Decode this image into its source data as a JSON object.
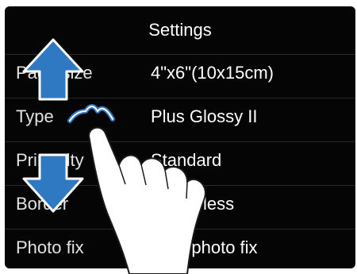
{
  "screen": {
    "title": "Settings"
  },
  "settings": [
    {
      "label": "Page size",
      "value": "4\"x6\"(10x15cm)"
    },
    {
      "label": "Type",
      "value": "Plus Glossy II"
    },
    {
      "label": "Print qlty",
      "value": "Standard"
    },
    {
      "label": "Border",
      "value": "Borderless"
    },
    {
      "label": "Photo fix",
      "value": "Auto photo fix"
    }
  ],
  "colors": {
    "screen_bg": "#050505",
    "arrow_fill": "#2f79c2",
    "highlight": "#2f79c2"
  },
  "icons": {
    "scroll_up": "up-arrow-icon",
    "scroll_down": "down-arrow-icon",
    "tap": "tap-highlight-icon",
    "hand": "finger-icon"
  }
}
